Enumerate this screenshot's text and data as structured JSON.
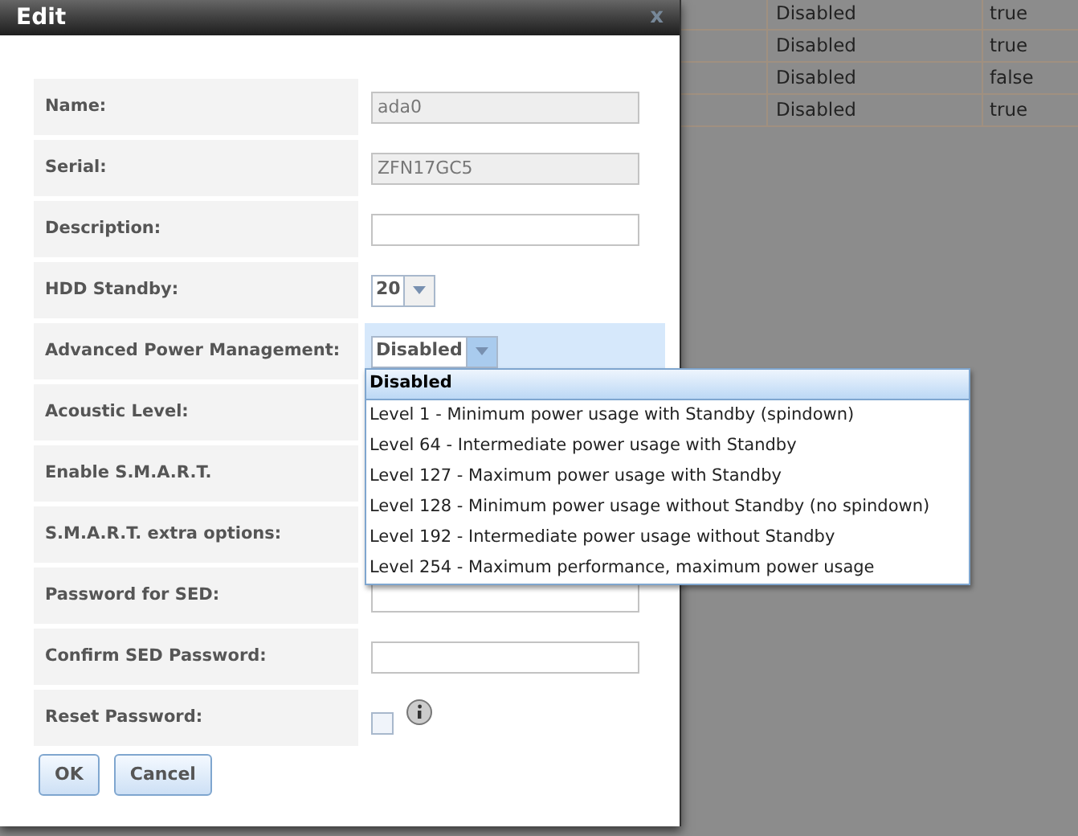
{
  "background_table": {
    "rows": [
      {
        "column_1": "Disabled",
        "column_2": "true"
      },
      {
        "column_1": "Disabled",
        "column_2": "true"
      },
      {
        "column_1": "Disabled",
        "column_2": "false"
      },
      {
        "column_1": "Disabled",
        "column_2": "true"
      }
    ]
  },
  "dialog": {
    "title": "Edit",
    "close": "x",
    "rows": [
      {
        "label": "Name:",
        "kind": "text",
        "value": "ada0",
        "disabled": true,
        "highlighted": false
      },
      {
        "label": "Serial:",
        "kind": "text",
        "value": "ZFN17GC5",
        "disabled": true,
        "highlighted": false
      },
      {
        "label": "Description:",
        "kind": "text",
        "disabled": false,
        "highlighted": false
      },
      {
        "label": "HDD Standby:",
        "kind": "select",
        "value": "20",
        "highlighted": false
      },
      {
        "label": "Advanced Power Management:",
        "kind": "select",
        "value": "Disabled",
        "highlighted": true,
        "open": true
      },
      {
        "label": "Acoustic Level:",
        "kind": "covered",
        "highlighted": false
      },
      {
        "label": "Enable S.M.A.R.T.",
        "kind": "covered",
        "highlighted": false
      },
      {
        "label": "S.M.A.R.T. extra options:",
        "kind": "covered",
        "highlighted": false
      },
      {
        "label": "Password for SED:",
        "kind": "text",
        "disabled": false,
        "highlighted": false
      },
      {
        "label": "Confirm SED Password:",
        "kind": "text",
        "disabled": false,
        "highlighted": false
      },
      {
        "label": "Reset Password:",
        "kind": "checkbox",
        "checked": false,
        "info": true,
        "highlighted": false
      }
    ],
    "dropdown": [
      {
        "label": "Disabled",
        "selected": true
      },
      {
        "label": "Level 1 - Minimum power usage with Standby (spindown)",
        "selected": false
      },
      {
        "label": "Level 64 - Intermediate power usage with Standby",
        "selected": false
      },
      {
        "label": "Level 127 - Maximum power usage with Standby",
        "selected": false
      },
      {
        "label": "Level 128 - Minimum power usage without Standby (no spindown)",
        "selected": false
      },
      {
        "label": "Level 192 - Intermediate power usage without Standby",
        "selected": false
      },
      {
        "label": "Level 254 - Maximum performance, maximum power usage",
        "selected": false
      }
    ],
    "buttons": [
      "OK",
      "Cancel"
    ]
  }
}
